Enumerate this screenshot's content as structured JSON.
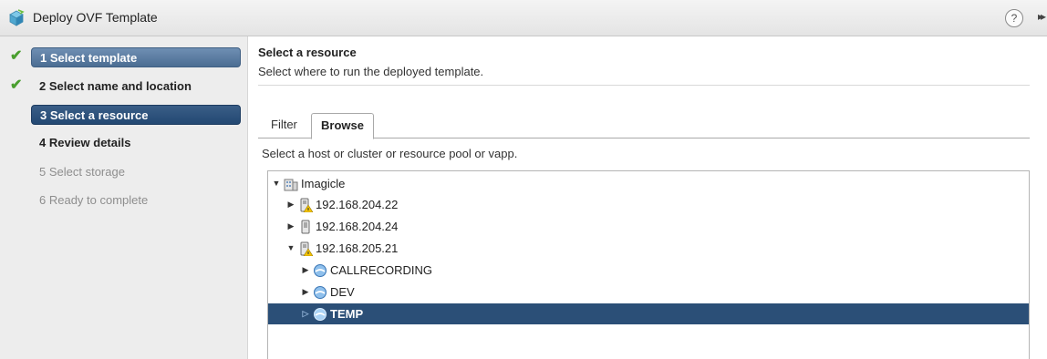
{
  "window": {
    "title": "Deploy OVF Template",
    "help_glyph": "?",
    "expand_glyph": "▸▸"
  },
  "steps": [
    {
      "label": "1 Select template",
      "state": "completed"
    },
    {
      "label": "2 Select name and location",
      "state": "completed"
    },
    {
      "label": "3 Select a resource",
      "state": "current"
    },
    {
      "label": "4 Review details",
      "state": "enabled"
    },
    {
      "label": "5 Select storage",
      "state": "disabled"
    },
    {
      "label": "6 Ready to complete",
      "state": "disabled"
    }
  ],
  "check_glyph": "✔",
  "main": {
    "title": "Select a resource",
    "subtitle": "Select where to run the deployed template.",
    "tabs": [
      {
        "label": "Filter",
        "active": false
      },
      {
        "label": "Browse",
        "active": true
      }
    ],
    "instruction": "Select a host or cluster or resource pool or vapp."
  },
  "tree": [
    {
      "label": "Imagicle",
      "type": "datacenter",
      "expanded": true,
      "selected": false
    },
    {
      "label": "192.168.204.22",
      "type": "host-warning",
      "expanded": false,
      "selected": false
    },
    {
      "label": "192.168.204.24",
      "type": "host",
      "expanded": false,
      "selected": false
    },
    {
      "label": "192.168.205.21",
      "type": "host-warning",
      "expanded": true,
      "selected": false
    },
    {
      "label": "CALLRECORDING",
      "type": "resource-pool",
      "expanded": false,
      "selected": false
    },
    {
      "label": "DEV",
      "type": "resource-pool",
      "expanded": false,
      "selected": false
    },
    {
      "label": "TEMP",
      "type": "resource-pool",
      "expanded": false,
      "selected": true
    }
  ],
  "colors": {
    "current_step": "#234873",
    "selected_row": "#2b4f77",
    "check": "#4a9f2f"
  }
}
